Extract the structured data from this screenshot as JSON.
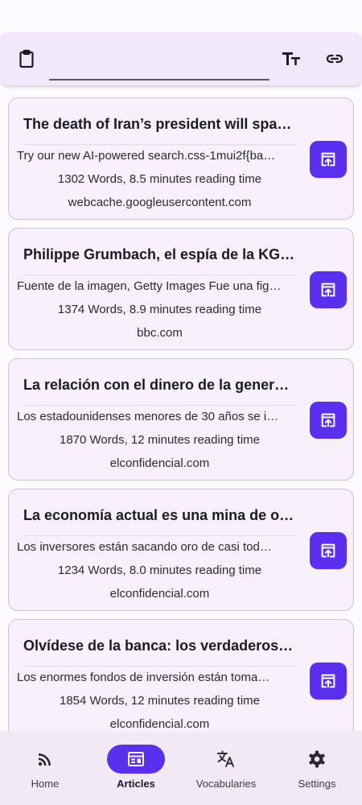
{
  "toolbar": {
    "url_value": "",
    "url_placeholder": "",
    "icons": [
      "clipboard-icon",
      "text-size-icon",
      "link-icon"
    ]
  },
  "articles": [
    {
      "title": "The death of Iran’s president will spar…",
      "excerpt": "Try our new AI-powered search.css-1mui2f{ba…",
      "stats": "1302 Words, 8.5 minutes reading time",
      "source": "webcache.googleusercontent.com"
    },
    {
      "title": "Philippe Grumbach, el espía de la KG…",
      "excerpt": "Fuente de la imagen, Getty Images Fue una fig…",
      "stats": "1374 Words, 8.9 minutes reading time",
      "source": "bbc.com"
    },
    {
      "title": "La relación con el dinero de la genera…",
      "excerpt": "Los estadounidenses menores de 30 años se i…",
      "stats": "1870 Words, 12 minutes reading time",
      "source": "elconfidencial.com"
    },
    {
      "title": "La economía actual es una mina de o…",
      "excerpt": "Los inversores están sacando oro de casi tod…",
      "stats": "1234 Words, 8.0 minutes reading time",
      "source": "elconfidencial.com"
    },
    {
      "title": "Olvídese de la banca: los verdaderos …",
      "excerpt": "Los enormes fondos de inversión están toma…",
      "stats": "1854 Words, 12 minutes reading time",
      "source": "elconfidencial.com"
    }
  ],
  "nav": {
    "items": [
      {
        "label": "Home",
        "icon": "rss-feed-icon"
      },
      {
        "label": "Articles",
        "icon": "articles-icon"
      },
      {
        "label": "Vocabularies",
        "icon": "translate-icon"
      },
      {
        "label": "Settings",
        "icon": "gear-icon"
      }
    ],
    "active": "Articles"
  },
  "colors": {
    "accent": "#5b2ff0",
    "card_bg": "#f6f1fc",
    "topbar_bg": "#efe9fb",
    "nav_bg": "#f0eaf7"
  }
}
